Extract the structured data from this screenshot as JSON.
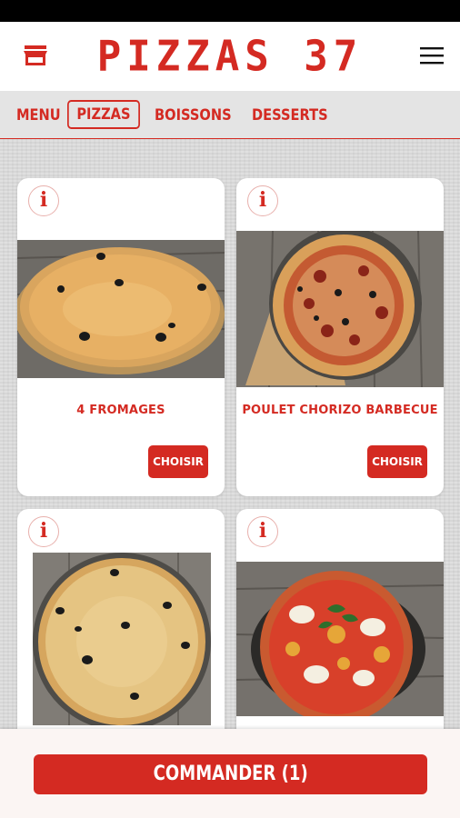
{
  "header": {
    "brand": "PIZZAS 37",
    "store_icon": "store-icon",
    "menu_icon": "hamburger-menu-icon"
  },
  "tabs": [
    {
      "label": "MENU",
      "active": false
    },
    {
      "label": "PIZZAS",
      "active": true
    },
    {
      "label": "BOISSONS",
      "active": false
    },
    {
      "label": "DESSERTS",
      "active": false
    }
  ],
  "products": [
    {
      "name": "4 FROMAGES",
      "info_label": "i",
      "button_label": "CHOISIR"
    },
    {
      "name": "POULET CHORIZO BARBECUE",
      "info_label": "i",
      "button_label": "CHOISIR"
    },
    {
      "name": "",
      "info_label": "i",
      "button_label": ""
    },
    {
      "name": "",
      "info_label": "i",
      "button_label": ""
    }
  ],
  "footer": {
    "order_button": "COMMANDER (1)"
  },
  "colors": {
    "brand_red": "#d42a22",
    "background": "#dcdcdc",
    "card": "#ffffff"
  }
}
